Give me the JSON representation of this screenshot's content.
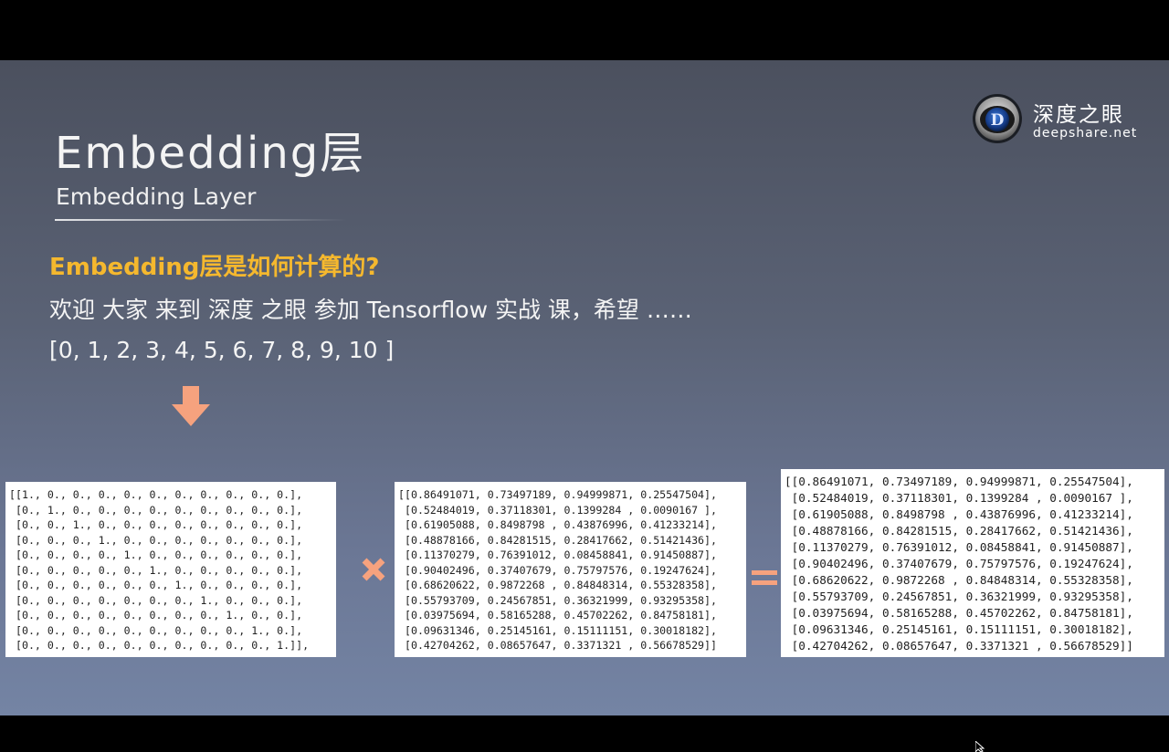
{
  "slide": {
    "title": "Embedding层",
    "subtitle": "Embedding Layer",
    "brand": {
      "name": "深度之眼",
      "url": "deepshare.net",
      "logo_letter": "D",
      "logo_icon": "deepshare-logo-icon"
    },
    "question": "Embedding层是如何计算的?",
    "sentence": "欢迎 大家 来到 深度 之眼 参加 Tensorflow 实战 课，希望 ……",
    "indices": "[0, 1, 2, 3, 4, 5, 6, 7, 8, 9, 10 ]",
    "operators": {
      "down_arrow_icon": "down-arrow-icon",
      "times_icon": "multiply-icon",
      "equals_icon": "equals-icon"
    },
    "colors": {
      "accent": "#f5b82e",
      "operator": "#f6a27e",
      "text": "#f4f4f4"
    }
  },
  "matrices": {
    "onehot_rows": [
      "[[1., 0., 0., 0., 0., 0., 0., 0., 0., 0., 0.],",
      " [0., 1., 0., 0., 0., 0., 0., 0., 0., 0., 0.],",
      " [0., 0., 1., 0., 0., 0., 0., 0., 0., 0., 0.],",
      " [0., 0., 0., 1., 0., 0., 0., 0., 0., 0., 0.],",
      " [0., 0., 0., 0., 1., 0., 0., 0., 0., 0., 0.],",
      " [0., 0., 0., 0., 0., 1., 0., 0., 0., 0., 0.],",
      " [0., 0., 0., 0., 0., 0., 1., 0., 0., 0., 0.],",
      " [0., 0., 0., 0., 0., 0., 0., 1., 0., 0., 0.],",
      " [0., 0., 0., 0., 0., 0., 0., 0., 1., 0., 0.],",
      " [0., 0., 0., 0., 0., 0., 0., 0., 0., 1., 0.],",
      " [0., 0., 0., 0., 0., 0., 0., 0., 0., 0., 1.]],"
    ],
    "weight_rows": [
      "[[0.86491071, 0.73497189, 0.94999871, 0.25547504],",
      " [0.52484019, 0.37118301, 0.1399284 , 0.0090167 ],",
      " [0.61905088, 0.8498798 , 0.43876996, 0.41233214],",
      " [0.48878166, 0.84281515, 0.28417662, 0.51421436],",
      " [0.11370279, 0.76391012, 0.08458841, 0.91450887],",
      " [0.90402496, 0.37407679, 0.75797576, 0.19247624],",
      " [0.68620622, 0.9872268 , 0.84848314, 0.55328358],",
      " [0.55793709, 0.24567851, 0.36321999, 0.93295358],",
      " [0.03975694, 0.58165288, 0.45702262, 0.84758181],",
      " [0.09631346, 0.25145161, 0.15111151, 0.30018182],",
      " [0.42704262, 0.08657647, 0.3371321 , 0.56678529]]"
    ],
    "result_rows": [
      "[[0.86491071, 0.73497189, 0.94999871, 0.25547504],",
      " [0.52484019, 0.37118301, 0.1399284 , 0.0090167 ],",
      " [0.61905088, 0.8498798 , 0.43876996, 0.41233214],",
      " [0.48878166, 0.84281515, 0.28417662, 0.51421436],",
      " [0.11370279, 0.76391012, 0.08458841, 0.91450887],",
      " [0.90402496, 0.37407679, 0.75797576, 0.19247624],",
      " [0.68620622, 0.9872268 , 0.84848314, 0.55328358],",
      " [0.55793709, 0.24567851, 0.36321999, 0.93295358],",
      " [0.03975694, 0.58165288, 0.45702262, 0.84758181],",
      " [0.09631346, 0.25145161, 0.15111151, 0.30018182],",
      " [0.42704262, 0.08657647, 0.3371321 , 0.56678529]]"
    ]
  }
}
